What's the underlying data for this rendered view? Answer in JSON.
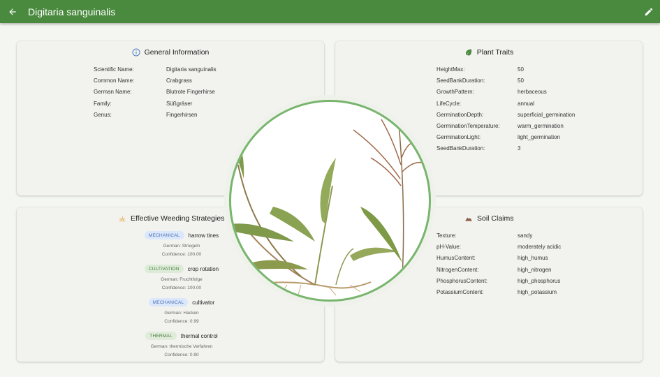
{
  "appbar": {
    "title": "Digitaria sanguinalis",
    "back_icon": "arrow-left-icon",
    "edit_icon": "pencil-icon",
    "color": "#4a8a3f"
  },
  "general": {
    "title": "General Information",
    "icon": "info-icon",
    "rows": [
      {
        "key": "Scientific Name:",
        "value": "Digitaria sanguinalis"
      },
      {
        "key": "Common Name:",
        "value": "Crabgrass"
      },
      {
        "key": "German Name:",
        "value": "Blutrote Fingerhirse"
      },
      {
        "key": "Family:",
        "value": "Süßgräser"
      },
      {
        "key": "Genus:",
        "value": "Fingerhirsen"
      }
    ]
  },
  "traits": {
    "title": "Plant Traits",
    "icon": "leaf-icon",
    "rows": [
      {
        "key": "HeightMax:",
        "value": "50"
      },
      {
        "key": "SeedBankDuration:",
        "value": "50"
      },
      {
        "key": "GrowthPattern:",
        "value": "herbaceous"
      },
      {
        "key": "LifeCycle:",
        "value": "annual"
      },
      {
        "key": "GerminationDepth:",
        "value": "superficial_germination"
      },
      {
        "key": "GerminationTemperature:",
        "value": "warm_germination"
      },
      {
        "key": "GerminationLight:",
        "value": "light_germination"
      },
      {
        "key": "SeedBankDuration:",
        "value": "3"
      }
    ]
  },
  "weeding": {
    "title": "Effective Weeding Strategies",
    "icon": "weeding-icon",
    "strategies": [
      {
        "type": "MECHANICAL",
        "name": "harrow tines",
        "german": "German: Striegeln",
        "confidence": "Confidence: 100.00"
      },
      {
        "type": "CULTIVATION",
        "name": "crop rotation",
        "german": "German: Fruchtfolge",
        "confidence": "Confidence: 100.00"
      },
      {
        "type": "MECHANICAL",
        "name": "cultivator",
        "german": "German: Hacken",
        "confidence": "Confidence: 0.99"
      },
      {
        "type": "THERMAL",
        "name": "thermal control",
        "german": "German: thermische Verfahren",
        "confidence": "Confidence: 0.90"
      }
    ]
  },
  "soil": {
    "title": "Soil Claims",
    "icon": "mountain-icon",
    "rows": [
      {
        "key": "Texture:",
        "value": "sandy"
      },
      {
        "key": "pH-Value:",
        "value": "moderately acidic"
      },
      {
        "key": "HumusContent:",
        "value": "high_humus"
      },
      {
        "key": "NitrogenContent:",
        "value": "high_nitrogen"
      },
      {
        "key": "PhosphorusContent:",
        "value": "high_phosphorus"
      },
      {
        "key": "PotassiumContent:",
        "value": "high_potassium"
      }
    ]
  }
}
